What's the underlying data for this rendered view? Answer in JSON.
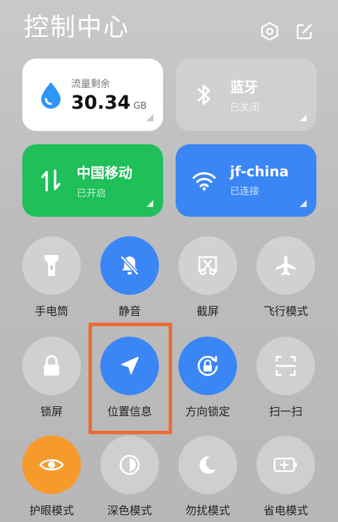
{
  "header": {
    "title": "控制中心"
  },
  "cards": {
    "data": {
      "label": "流量剩余",
      "value": "30.34",
      "unit": "GB"
    },
    "bluetooth": {
      "title": "蓝牙",
      "status": "已关闭"
    },
    "cellular": {
      "title": "中国移动",
      "status": "已开启"
    },
    "wifi": {
      "title": "jf-china",
      "status": "已连接"
    }
  },
  "toggles": [
    {
      "label": "手电筒"
    },
    {
      "label": "静音"
    },
    {
      "label": "截屏"
    },
    {
      "label": "飞行模式"
    },
    {
      "label": "锁屏"
    },
    {
      "label": "位置信息"
    },
    {
      "label": "方向锁定"
    },
    {
      "label": "扫一扫"
    },
    {
      "label": "护眼模式"
    },
    {
      "label": "深色模式"
    },
    {
      "label": "勿扰模式"
    },
    {
      "label": "省电模式"
    }
  ],
  "colors": {
    "accent_blue": "#3a86f5",
    "cellular_green": "#1fbf5a",
    "eye_orange": "#f79a2c",
    "highlight_orange": "#f06a34"
  }
}
